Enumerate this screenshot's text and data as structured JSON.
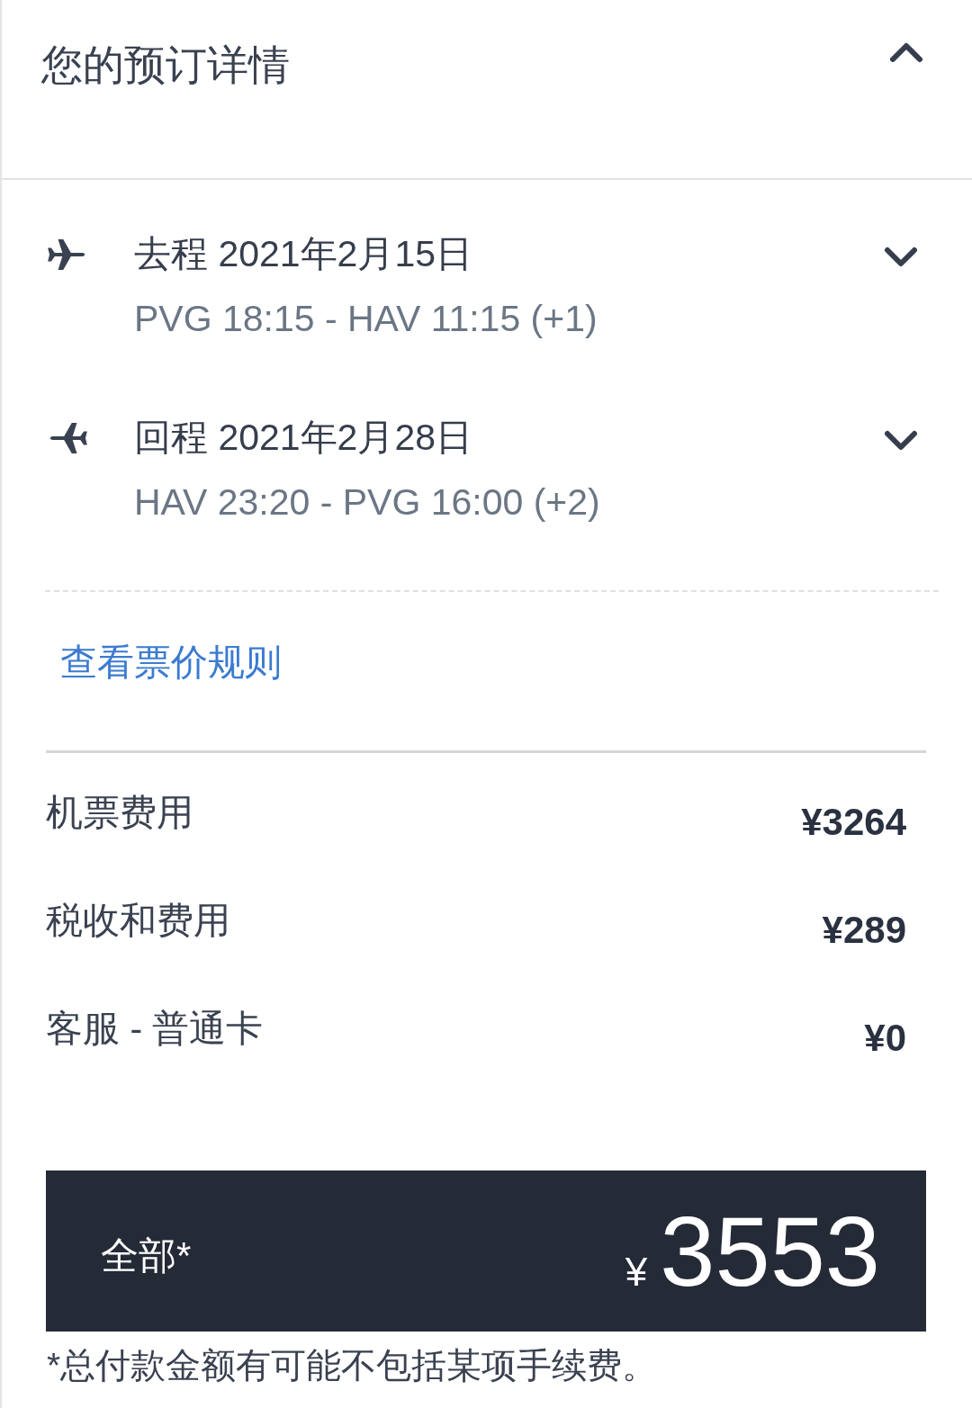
{
  "header": {
    "title": "您的预订详情",
    "expanded": true
  },
  "flights": [
    {
      "kind": "outbound",
      "title": "去程 2021年2月15日",
      "route": "PVG 18:15 - HAV 11:15 (+1)",
      "expanded": false
    },
    {
      "kind": "return",
      "title": "回程 2021年2月28日",
      "route": "HAV 23:20 - PVG 16:00 (+2)",
      "expanded": false
    }
  ],
  "fare_rules_link": "查看票价规则",
  "price_rows": [
    {
      "label": "机票费用",
      "amount": "¥3264"
    },
    {
      "label": "税收和费用",
      "amount": "¥289"
    },
    {
      "label": "客服 - 普通卡",
      "amount": "¥0"
    }
  ],
  "total": {
    "label": "全部*",
    "currency": "¥",
    "amount": "3553"
  },
  "footnote": "*总付款金额有可能不包括某项手续费。"
}
